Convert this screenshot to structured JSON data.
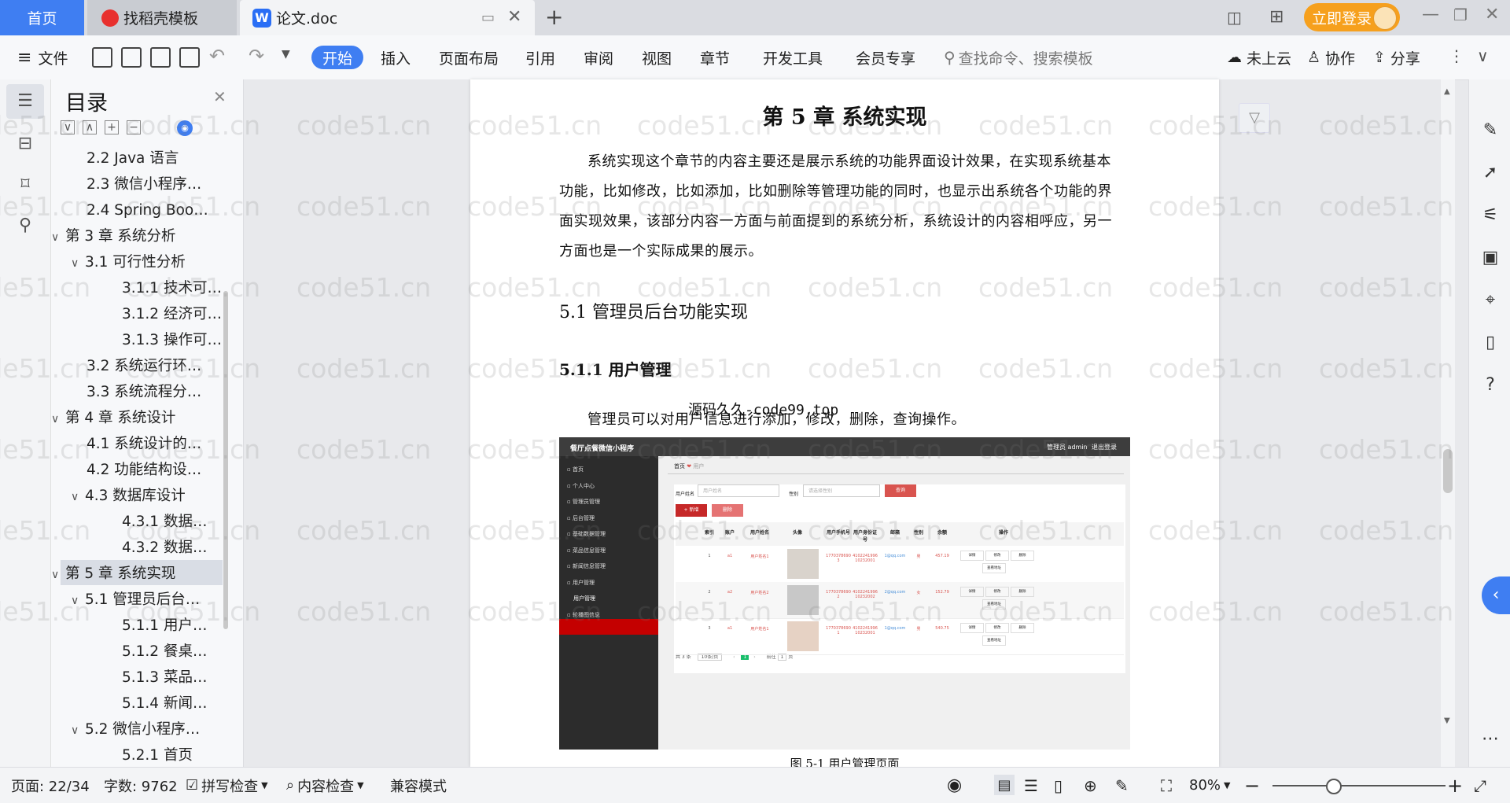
{
  "tabs": {
    "home": "首页",
    "template": "找稻壳模板",
    "doc": "论文.doc",
    "login": "立即登录"
  },
  "toolbar": {
    "file": "文件",
    "menus": [
      "开始",
      "插入",
      "页面布局",
      "引用",
      "审阅",
      "视图",
      "章节",
      "开发工具",
      "会员专享"
    ],
    "search_placeholder": "查找命令、搜索模板",
    "cloud": "未上云",
    "collab": "协作",
    "share": "分享"
  },
  "toc": {
    "title": "目录",
    "items": [
      {
        "label": "2.2 Java 语言",
        "level": 2
      },
      {
        "label": "2.3 微信小程序…",
        "level": 2
      },
      {
        "label": "2.4 Spring Boo…",
        "level": 2
      },
      {
        "label": "第 3 章  系统分析",
        "level": 1
      },
      {
        "label": "3.1 可行性分析",
        "level": 2
      },
      {
        "label": "3.1.1 技术可…",
        "level": 3
      },
      {
        "label": "3.1.2 经济可…",
        "level": 3
      },
      {
        "label": "3.1.3 操作可…",
        "level": 3
      },
      {
        "label": "3.2 系统运行环…",
        "level": 2
      },
      {
        "label": "3.3 系统流程分…",
        "level": 2
      },
      {
        "label": "第 4 章  系统设计",
        "level": 1
      },
      {
        "label": "4.1 系统设计的…",
        "level": 2
      },
      {
        "label": "4.2 功能结构设…",
        "level": 2
      },
      {
        "label": "4.3 数据库设计",
        "level": 2
      },
      {
        "label": "4.3.1 数据…",
        "level": 3
      },
      {
        "label": "4.3.2 数据…",
        "level": 3
      },
      {
        "label": "第 5 章  系统实现",
        "level": 1
      },
      {
        "label": "5.1 管理员后台…",
        "level": 2
      },
      {
        "label": "5.1.1 用户…",
        "level": 3
      },
      {
        "label": "5.1.2 餐桌…",
        "level": 3
      },
      {
        "label": "5.1.3 菜品…",
        "level": 3
      },
      {
        "label": "5.1.4 新闻…",
        "level": 3
      },
      {
        "label": "5.2 微信小程序…",
        "level": 2
      },
      {
        "label": "5.2.1 首页",
        "level": 3
      }
    ]
  },
  "document": {
    "chapter_title": "第 5 章  系统实现",
    "para1_lines": [
      "系统实现这个章节的内容主要还是展示系统的功能界面设计效果，在实现系统基本",
      "功能，比如修改，比如添加，比如删除等管理功能的同时，也显示出系统各个功能的界",
      "面实现效果，该部分内容一方面与前面提到的系统分析，系统设计的内容相呼应，另一",
      "方面也是一个实际成果的展示。"
    ],
    "h2": "5.1 管理员后台功能实现",
    "h3": "5.1.1  用户管理",
    "overlay_text": "源码久久-code99.top",
    "para2": "管理员可以对用户信息进行添加，修改，删除，查询操作。",
    "figure_caption": "图 5-1  用户管理页面",
    "watermark": "code51.cn"
  },
  "screenshot": {
    "app_title": "餐厅点餐微信小程序",
    "admin_label": "管理员 admin",
    "logout": "退出登录",
    "breadcrumb_home": "首页",
    "breadcrumb_current": "用户",
    "side_items": [
      "首页",
      "个人中心",
      "管理员管理",
      "后台管理",
      "基础数据管理",
      "菜品信息管理",
      "新闻信息管理",
      "用户管理",
      "用户管理",
      "轮播图信息"
    ],
    "search_label_name": "用户姓名",
    "search_placeholder_name": "用户姓名",
    "search_label_gender": "性别",
    "search_placeholder_gender": "请选择性别",
    "search_button": "查询",
    "add_button": "+ 新增",
    "delete_button": "删除",
    "columns": [
      "索引",
      "账户",
      "用户姓名",
      "头像",
      "用户手机号",
      "用户身份证号",
      "邮箱",
      "性别",
      "余额",
      "操作"
    ],
    "rows": [
      {
        "index": "1",
        "account": "a1",
        "name": "用户姓名1",
        "phone": "17703786903",
        "idcard": "410224199610232001",
        "email": "1@qq.com",
        "gender": "男",
        "balance": "457.19"
      },
      {
        "index": "2",
        "account": "a2",
        "name": "用户姓名2",
        "phone": "17703786902",
        "idcard": "410224199610232002",
        "email": "2@qq.com",
        "gender": "女",
        "balance": "152.79"
      },
      {
        "index": "3",
        "account": "a1",
        "name": "用户姓名1",
        "phone": "17703786901",
        "idcard": "410224199610232001",
        "email": "1@qq.com",
        "gender": "男",
        "balance": "540.75"
      }
    ],
    "actions": [
      "详情",
      "修改",
      "删除",
      "查看地址"
    ],
    "pager_total": "共 3 条",
    "pager_size": "10条/页",
    "pager_current": "1",
    "pager_goto": "前往",
    "pager_goto_value": "1",
    "pager_page_suffix": "页"
  },
  "statusbar": {
    "page": "页面: 22/34",
    "words": "字数: 9762",
    "spell": "拼写检查",
    "content": "内容检查",
    "compat": "兼容模式",
    "zoom": "80%"
  },
  "colors": {
    "accent": "#3f7ef2",
    "login": "#f6a01d",
    "danger": "#d9544f"
  }
}
